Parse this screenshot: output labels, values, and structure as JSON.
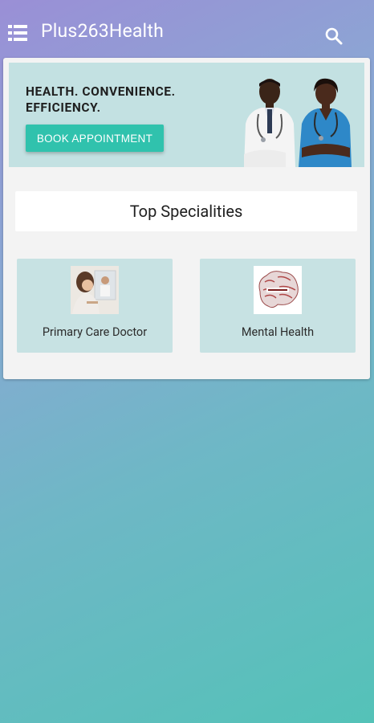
{
  "app": {
    "title": "Plus263Health"
  },
  "hero": {
    "tagline_line1": "HEALTH. CONVENIENCE.",
    "tagline_line2": "EFFICIENCY.",
    "cta_label": "BOOK APPOINTMENT"
  },
  "specialities": {
    "heading": "Top Specialities",
    "items": [
      {
        "label": "Primary Care Doctor",
        "icon": "doctor-photo"
      },
      {
        "label": "Mental Health",
        "icon": "brain-photo"
      }
    ]
  },
  "icons": {
    "menu": "menu-list-icon",
    "search": "search-icon"
  },
  "colors": {
    "accent": "#30c2ad",
    "hero_background": "#c3e1e2",
    "tile_background": "#c7e2e3"
  }
}
